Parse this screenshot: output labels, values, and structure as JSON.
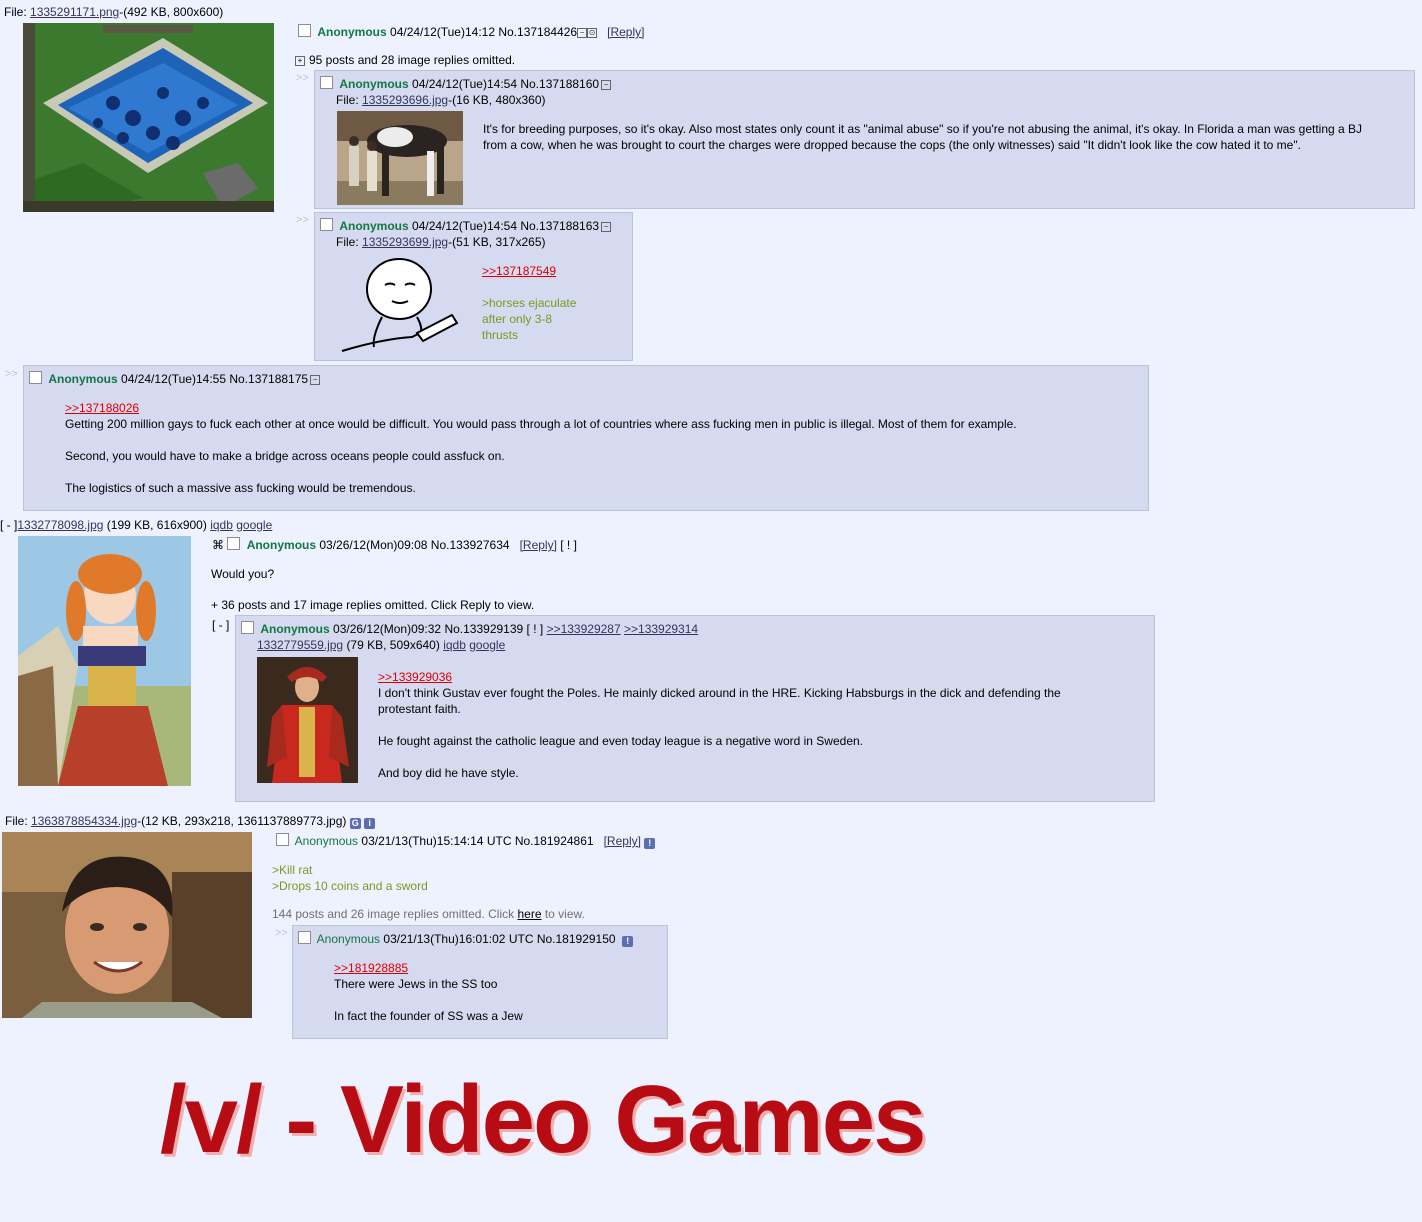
{
  "p1": {
    "file_label": "File:",
    "file_name": "1335291171.png",
    "file_info": "-(492 KB, 800x600)",
    "name": "Anonymous",
    "datetime": "04/24/12(Tue)14:12",
    "no": "No.137184426",
    "reply_label": "[Reply]",
    "omitted": "95 posts and 28 image replies omitted.",
    "r1": {
      "arrows": ">>",
      "name": "Anonymous",
      "datetime": "04/24/12(Tue)14:54",
      "no": "No.137188160",
      "file_label": "File:",
      "file_name": "1335293696.jpg",
      "file_info": "-(16 KB, 480x360)",
      "text": "It's for breeding purposes, so it's okay. Also most states only count it as \"animal abuse\" so if you're not abusing the animal, it's okay. In Florida a man was getting a BJ from a cow, when he was brought to court the charges were dropped because the cops (the only witnesses) said \"It didn't look like the cow hated it to me\"."
    },
    "r2": {
      "arrows": ">>",
      "name": "Anonymous",
      "datetime": "04/24/12(Tue)14:54",
      "no": "No.137188163",
      "file_label": "File:",
      "file_name": "1335293699.jpg",
      "file_info": "-(51 KB, 317x265)",
      "quote": ">>137187549",
      "green1": ">horses ejaculate",
      "green2": "after only 3-8",
      "green3": "thrusts"
    },
    "r3": {
      "arrows": ">>",
      "name": "Anonymous",
      "datetime": "04/24/12(Tue)14:55",
      "no": "No.137188175",
      "quote": ">>137188026",
      "line1": "Getting 200 million gays to fuck each other at once would be difficult. You would pass through a lot of countries where ass fucking men in public is illegal. Most of them for example.",
      "line2": "Second, you would have to make a bridge across oceans people could assfuck on.",
      "line3": "The logistics of such a massive ass fucking would be tremendous."
    }
  },
  "p2": {
    "file_prefix": "[ - ]",
    "file_name": "1332778098.jpg",
    "file_info": "(199 KB, 616x900)",
    "iqdb": "iqdb",
    "google": "google",
    "name": "Anonymous",
    "datetime": "03/26/12(Mon)09:08",
    "no": "No.133927634",
    "reply_label": "[Reply]",
    "excl": "[ ! ]",
    "text": "Would you?",
    "omitted": "+ 36 posts and 17 image replies omitted. Click Reply to view.",
    "r1": {
      "collapse": "[ - ]",
      "name": "Anonymous",
      "datetime": "03/26/12(Mon)09:32",
      "no": "No.133929139",
      "excl": "[ ! ]",
      "backlink1": ">>133929287",
      "backlink2": ">>133929314",
      "file_name": "1332779559.jpg",
      "file_info": "(79 KB, 509x640)",
      "iqdb": "iqdb",
      "google": "google",
      "quote": ">>133929036",
      "line1": "I don't think Gustav ever fought the Poles. He mainly dicked around in the HRE. Kicking Habsburgs in the dick and defending the protestant faith.",
      "line2": "He fought against the catholic league and even today league is a negative word in Sweden.",
      "line3": "And boy did he have style."
    }
  },
  "p3": {
    "file_label": "File:",
    "file_name": "1363878854334.jpg",
    "file_info": "-(12 KB, 293x218, 1361137889773.jpg)",
    "name": "Anonymous",
    "datetime": "03/21/13(Thu)15:14:14 UTC",
    "no": "No.181924861",
    "reply_label": "[Reply]",
    "green1": ">Kill rat",
    "green2": ">Drops 10 coins and a sword",
    "omitted_a": "144 posts and 26 image replies omitted. Click ",
    "omitted_here": "here",
    "omitted_b": " to view.",
    "r1": {
      "arrows": ">>",
      "name": "Anonymous",
      "datetime": "03/21/13(Thu)16:01:02 UTC",
      "no": "No.181929150",
      "quote": ">>181928885",
      "line1": "There were Jews in the SS too",
      "line2": "In fact the founder of SS was a Jew"
    }
  },
  "banner": "/v/ - Video Games",
  "colors": {
    "name": "#117743",
    "quote": "#dd0000",
    "greentext": "#789922",
    "reply_bg": "#d6daf0",
    "banner": "#b80c14"
  }
}
